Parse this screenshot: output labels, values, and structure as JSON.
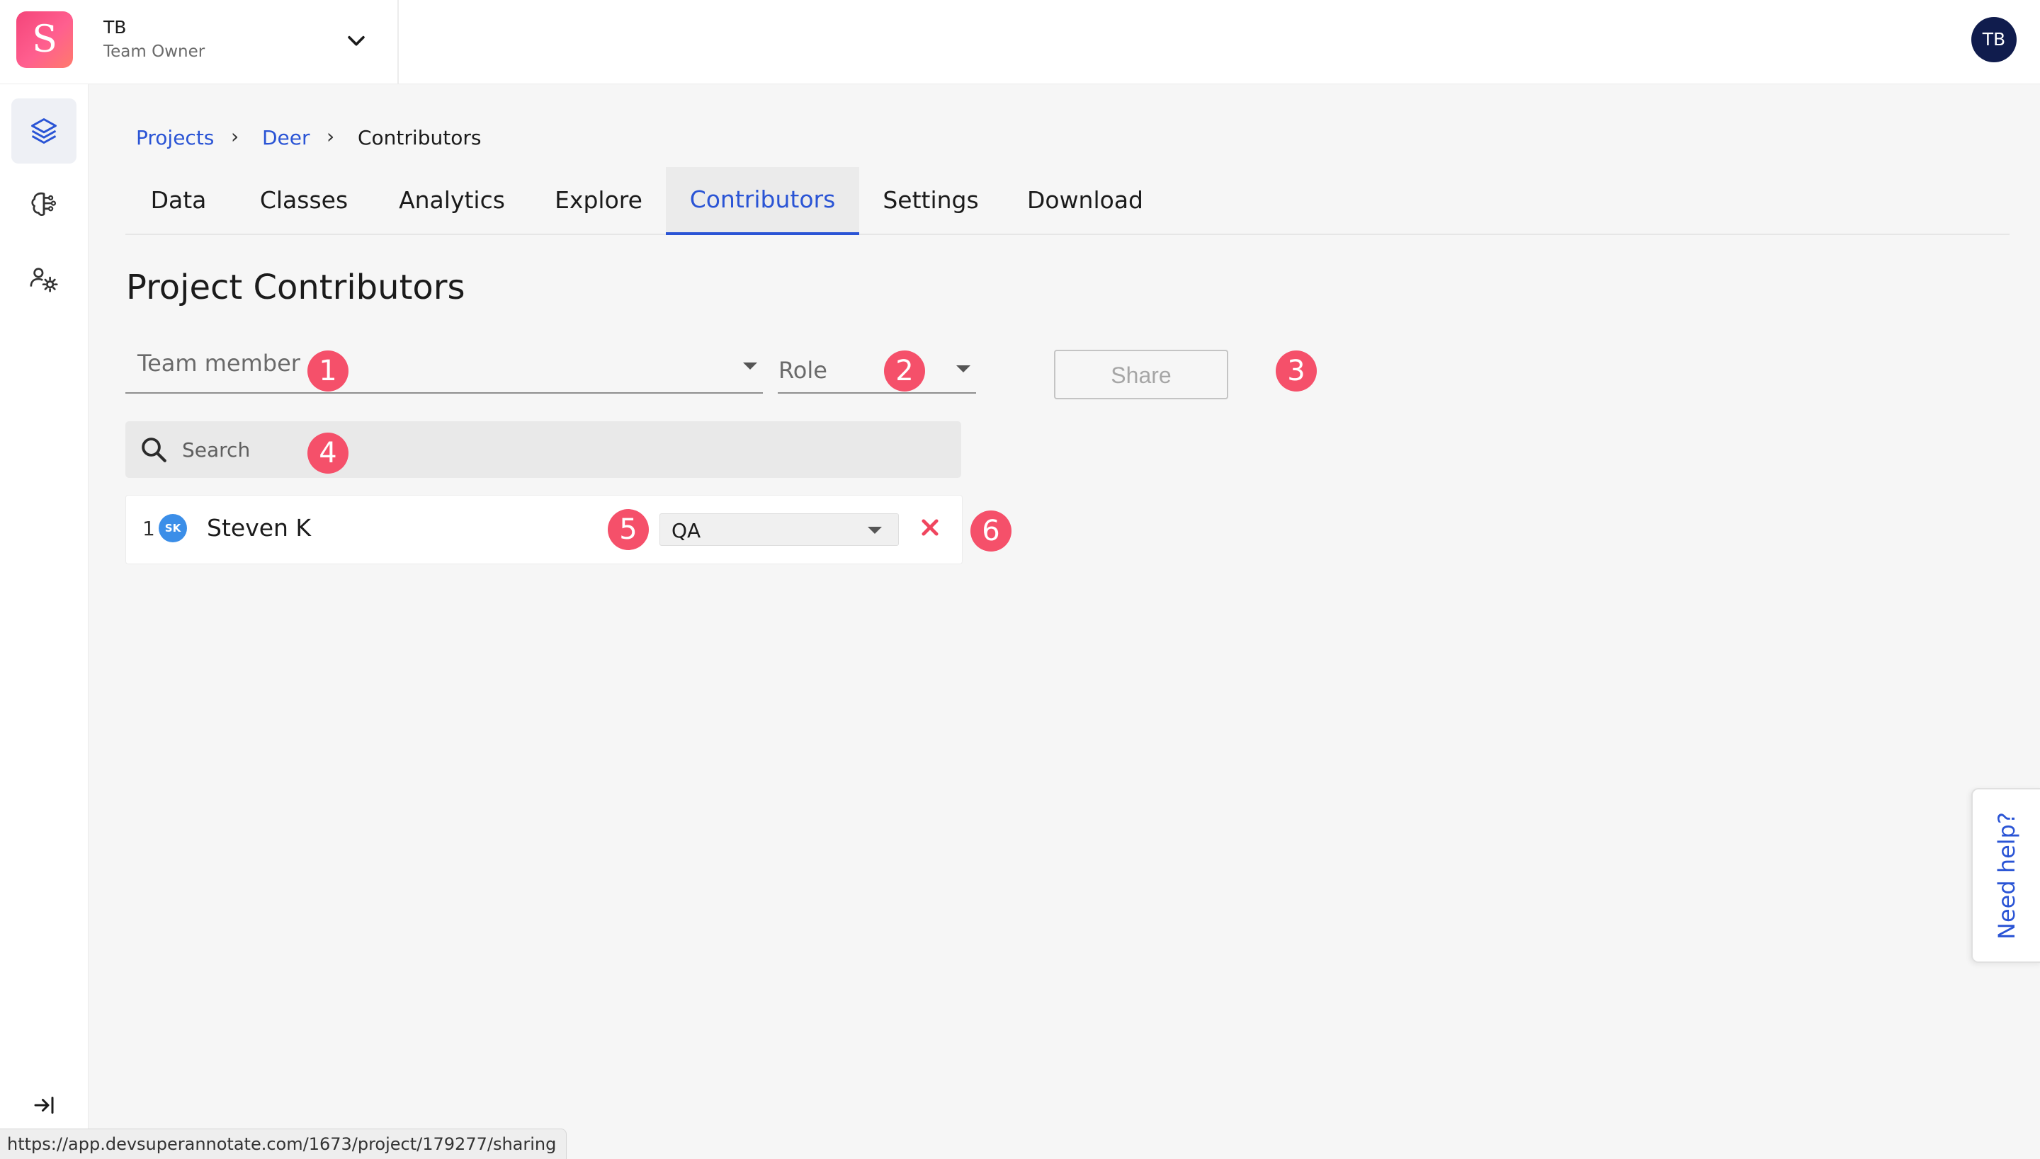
{
  "team": {
    "logo_letter": "S",
    "name": "TB",
    "role": "Team Owner"
  },
  "user": {
    "initials": "TB"
  },
  "breadcrumb": {
    "items": [
      {
        "label": "Projects"
      },
      {
        "label": "Deer"
      },
      {
        "label": "Contributors"
      }
    ],
    "separator": "›"
  },
  "tabs": [
    {
      "label": "Data"
    },
    {
      "label": "Classes"
    },
    {
      "label": "Analytics"
    },
    {
      "label": "Explore"
    },
    {
      "label": "Contributors",
      "active": true
    },
    {
      "label": "Settings"
    },
    {
      "label": "Download"
    }
  ],
  "page": {
    "title": "Project Contributors"
  },
  "form": {
    "team_member_placeholder": "Team member",
    "role_placeholder": "Role",
    "share_label": "Share"
  },
  "search": {
    "placeholder": "Search"
  },
  "contributors": [
    {
      "index": "1",
      "initials": "SK",
      "name": "Steven K",
      "role": "QA",
      "avatar_color": "#3b8ee8"
    }
  ],
  "callouts": [
    "1",
    "2",
    "3",
    "4",
    "5",
    "6"
  ],
  "help": {
    "label": "Need help?"
  },
  "status_bar": {
    "url": "https://app.devsuperannotate.com/1673/project/179277/sharing"
  },
  "icons": {
    "sidebar": [
      "layers-icon",
      "brain-icon",
      "team-settings-icon"
    ],
    "collapse": "collapse-sidebar-icon"
  },
  "colors": {
    "accent": "#2a54d5",
    "callout": "#f5506a",
    "remove": "#f0455e",
    "avatar": "#101c4d"
  }
}
